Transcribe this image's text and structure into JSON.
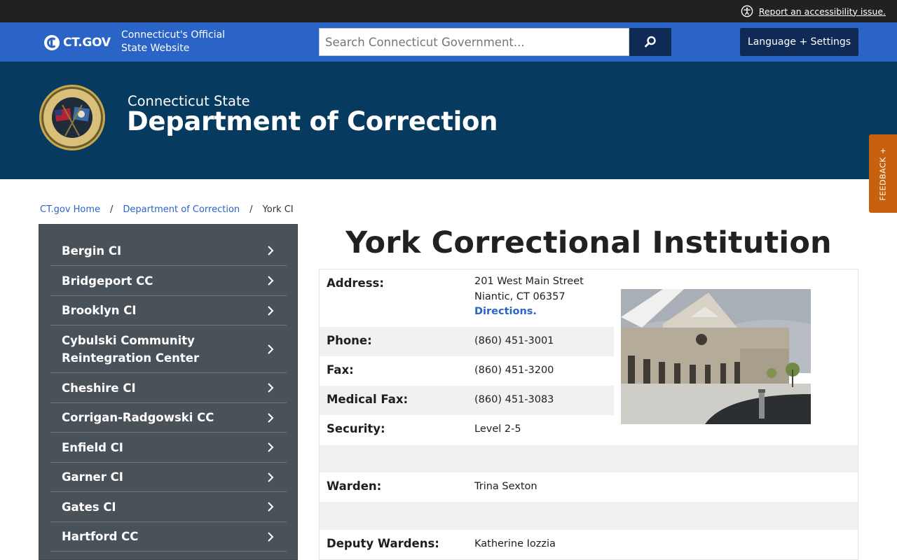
{
  "topbar": {
    "accessibility_link": "Report an accessibility issue."
  },
  "govbar": {
    "logo_text": "CT.GOV",
    "official_line1": "Connecticut's Official",
    "official_line2": "State Website",
    "search_placeholder": "Search Connecticut Government...",
    "language_button": "Language + Settings"
  },
  "agency": {
    "subtitle": "Connecticut State",
    "title": "Department of Correction"
  },
  "feedback": {
    "label": "FEEDBACK +"
  },
  "breadcrumb": {
    "home": "CT.gov Home",
    "dept": "Department of Correction",
    "current": "York CI"
  },
  "sidebar": {
    "items": [
      {
        "label": "Bergin CI"
      },
      {
        "label": "Bridgeport CC"
      },
      {
        "label": "Brooklyn CI"
      },
      {
        "label": "Cybulski Community Reintegration Center"
      },
      {
        "label": "Cheshire CI"
      },
      {
        "label": "Corrigan-Radgowski CC"
      },
      {
        "label": "Enfield CI"
      },
      {
        "label": "Garner CI"
      },
      {
        "label": "Gates CI"
      },
      {
        "label": "Hartford CC"
      }
    ]
  },
  "main": {
    "title": "York Correctional Institution",
    "address_label": "Address:",
    "address_line1": "201 West Main Street",
    "address_line2": "Niantic, CT 06357",
    "directions": "Directions.",
    "phone_label": "Phone:",
    "phone": "(860) 451-3001",
    "fax_label": "Fax:",
    "fax": "(860) 451-3200",
    "medfax_label": "Medical Fax:",
    "medfax": "(860) 451-3083",
    "security_label": "Security:",
    "security": "Level 2-5",
    "warden_label": "Warden:",
    "warden": "Trina Sexton",
    "deputy_label": "Deputy Wardens:",
    "deputy": "Katherine Iozzia"
  },
  "colors": {
    "gov_blue": "#2a64c7",
    "navy": "#0f2a55",
    "agency_bg": "#063a5f",
    "sidebar_bg": "#4a5259",
    "feedback_orange": "#c8610e"
  }
}
